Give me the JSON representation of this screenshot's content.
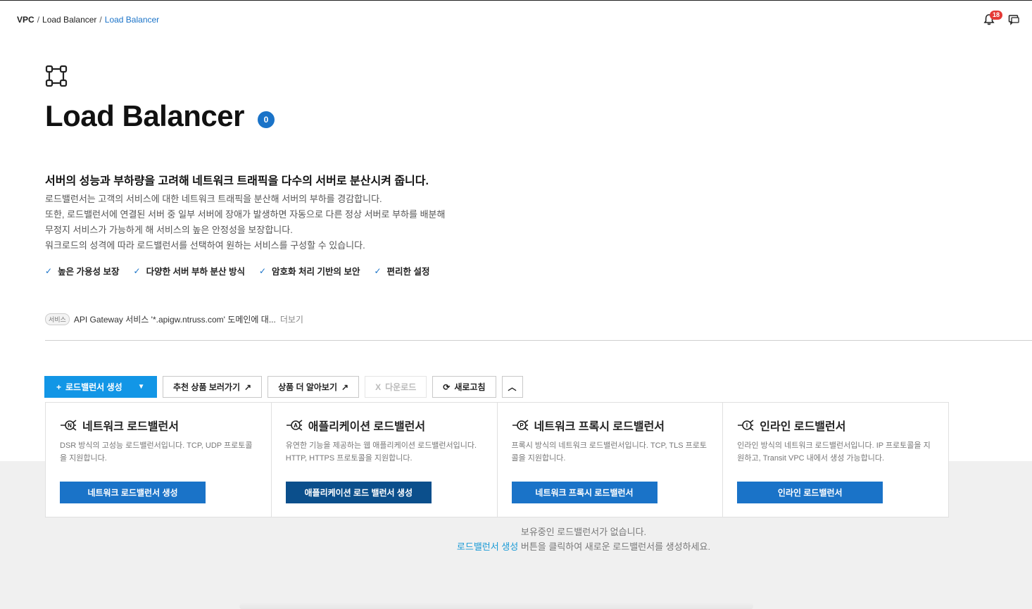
{
  "breadcrumb": {
    "root": "VPC",
    "middle": "Load Balancer",
    "current": "Load Balancer"
  },
  "header": {
    "notification_count": "18"
  },
  "page": {
    "title": "Load Balancer",
    "count": "0",
    "headline": "서버의 성능과 부하량을 고려해 네트워크 트래픽을 다수의 서버로 분산시켜 줍니다.",
    "description": [
      "로드밸런서는 고객의 서비스에 대한 네트워크 트래픽을 분산해 서버의 부하를 경감합니다.",
      "또한, 로드밸런서에 연결된 서버 중 일부 서버에 장애가 발생하면 자동으로 다른 정상 서버로 부하를 배분해",
      "무정지 서비스가 가능하게 해 서비스의 높은 안정성을 보장합니다.",
      "워크로드의 성격에 따라 로드밸런서를 선택하여 원하는 서비스를 구성할 수 있습니다."
    ],
    "features": [
      "높은 가용성 보장",
      "다양한 서버 부하 분산 방식",
      "암호화 처리 기반의 보안",
      "편리한 설정"
    ]
  },
  "notice": {
    "tag": "서비스",
    "text": "API Gateway 서비스 '*.apigw.ntruss.com' 도메인에 대...",
    "more": "더보기"
  },
  "toolbar": {
    "create": "로드밸런서 생성",
    "recommend": "추천 상품 보러가기",
    "learn_more": "상품 더 알아보기",
    "download": "다운로드",
    "refresh": "새로고침"
  },
  "cards": [
    {
      "badge": "N",
      "title": "네트워크 로드밸런서",
      "desc": "DSR 방식의 고성능 로드밸런서입니다. TCP, UDP 프로토콜을 지원합니다.",
      "button": "네트워크 로드밸런서 생성"
    },
    {
      "badge": "A",
      "title": "애플리케이션 로드밸런서",
      "desc": "유연한 기능을 제공하는 웹 애플리케이션 로드밸런서입니다. HTTP, HTTPS 프로토콜을 지원합니다.",
      "button": "애플리케이션 로드 밸런서 생성"
    },
    {
      "badge": "P",
      "title": "네트워크 프록시 로드밸런서",
      "desc": "프록시 방식의 네트워크 로드밸런서입니다. TCP, TLS 프로토콜을 지원합니다.",
      "button": "네트워크 프록시 로드밸런서"
    },
    {
      "badge": "I",
      "title": "인라인 로드밸런서",
      "desc": "인라인 방식의 네트워크 로드밸런서입니다. IP 프로토콜을 지원하고, Transit VPC 내에서 생성 가능합니다.",
      "button": "인라인 로드밸런서"
    }
  ],
  "empty": {
    "line1": "보유중인 로드밸런서가 없습니다.",
    "link": "로드밸런서 생성",
    "line2_rest": " 버튼을 클릭하여 새로운 로드밸런서를 생성하세요."
  },
  "colors": {
    "accent": "#1296e6",
    "primary": "#1a73c8",
    "dark_primary": "#0b4f8c",
    "badge_red": "#e53935"
  }
}
